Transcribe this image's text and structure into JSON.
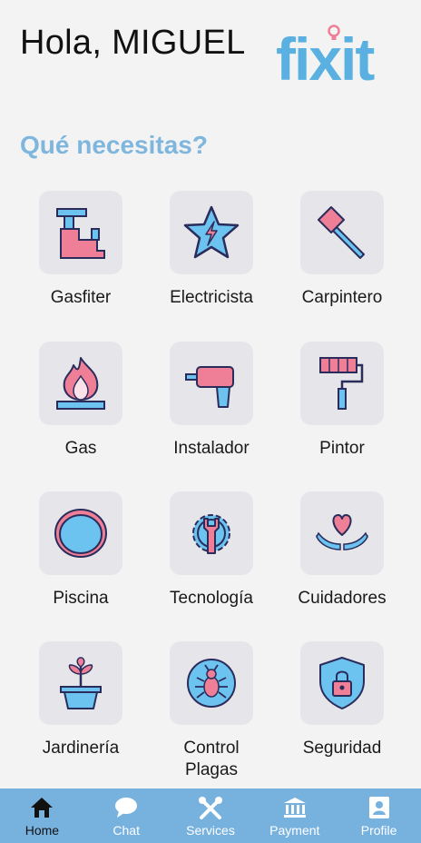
{
  "header": {
    "greeting": "Hola, MIGUEL",
    "logo_text": "fixit"
  },
  "main": {
    "question": "Qué necesitas?",
    "services": [
      {
        "label": "Gasfiter",
        "icon": "pipe-icon"
      },
      {
        "label": "Electricista",
        "icon": "lightning-star-icon"
      },
      {
        "label": "Carpintero",
        "icon": "hammer-icon"
      },
      {
        "label": "Gas",
        "icon": "flame-icon"
      },
      {
        "label": "Instalador",
        "icon": "drill-icon"
      },
      {
        "label": "Pintor",
        "icon": "paint-roller-icon"
      },
      {
        "label": "Piscina",
        "icon": "pool-icon"
      },
      {
        "label": "Tecnología",
        "icon": "gear-wrench-icon"
      },
      {
        "label": "Cuidadores",
        "icon": "heart-hands-icon"
      },
      {
        "label": "Jardinería",
        "icon": "plant-pot-icon"
      },
      {
        "label": "Control\nPlagas",
        "icon": "bug-icon"
      },
      {
        "label": "Seguridad",
        "icon": "shield-lock-icon"
      }
    ]
  },
  "tabbar": {
    "items": [
      {
        "label": "Home",
        "icon": "home-icon",
        "active": true
      },
      {
        "label": "Chat",
        "icon": "chat-icon",
        "active": false
      },
      {
        "label": "Services",
        "icon": "tools-icon",
        "active": false
      },
      {
        "label": "Payment",
        "icon": "bank-icon",
        "active": false
      },
      {
        "label": "Profile",
        "icon": "profile-icon",
        "active": false
      }
    ]
  },
  "colors": {
    "brand_blue": "#77b2df",
    "accent_pink": "#ef7f96",
    "icon_blue": "#6cc3ef",
    "outline": "#2a2d5c"
  }
}
